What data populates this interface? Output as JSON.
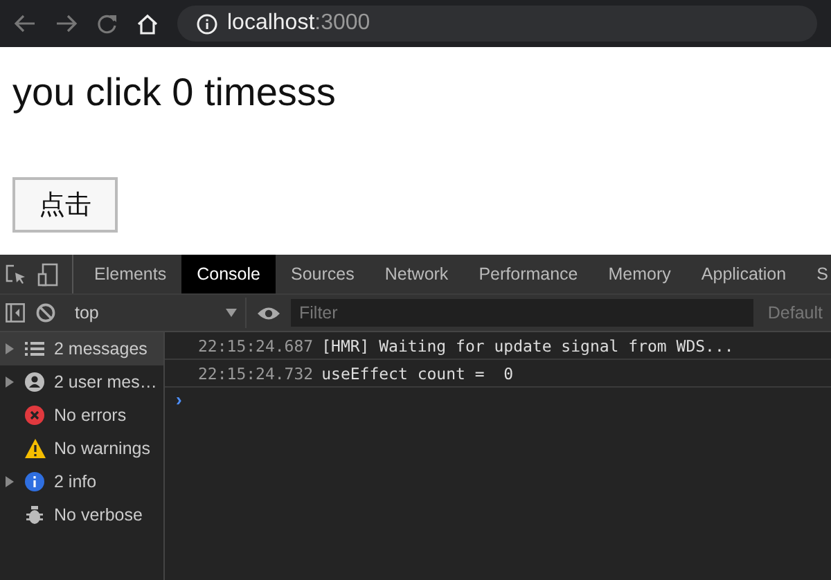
{
  "browser": {
    "url_host": "localhost",
    "url_port": ":3000"
  },
  "page": {
    "heading": "you click 0 timesss",
    "button": "点击"
  },
  "devtools": {
    "tabs": [
      {
        "label": "Elements",
        "selected": false
      },
      {
        "label": "Console",
        "selected": true
      },
      {
        "label": "Sources",
        "selected": false
      },
      {
        "label": "Network",
        "selected": false
      },
      {
        "label": "Performance",
        "selected": false
      },
      {
        "label": "Memory",
        "selected": false
      },
      {
        "label": "Application",
        "selected": false
      },
      {
        "label": "S",
        "selected": false
      }
    ],
    "context": "top",
    "filter": {
      "placeholder": "Filter"
    },
    "levels": "Default",
    "sidebar": [
      {
        "kind": "list",
        "label": "2 messages",
        "expandable": true,
        "selected": true
      },
      {
        "kind": "user",
        "label": "2 user mes…",
        "expandable": true,
        "selected": false
      },
      {
        "kind": "error",
        "label": "No errors",
        "expandable": false,
        "selected": false
      },
      {
        "kind": "warning",
        "label": "No warnings",
        "expandable": false,
        "selected": false
      },
      {
        "kind": "info",
        "label": "2 info",
        "expandable": true,
        "selected": false
      },
      {
        "kind": "verbose",
        "label": "No verbose",
        "expandable": false,
        "selected": false
      }
    ],
    "messages": [
      {
        "time": "22:15:24.687",
        "text": "[HMR] Waiting for update signal from WDS..."
      },
      {
        "time": "22:15:24.732",
        "text": "useEffect count =  0"
      }
    ],
    "prompt": "›"
  }
}
